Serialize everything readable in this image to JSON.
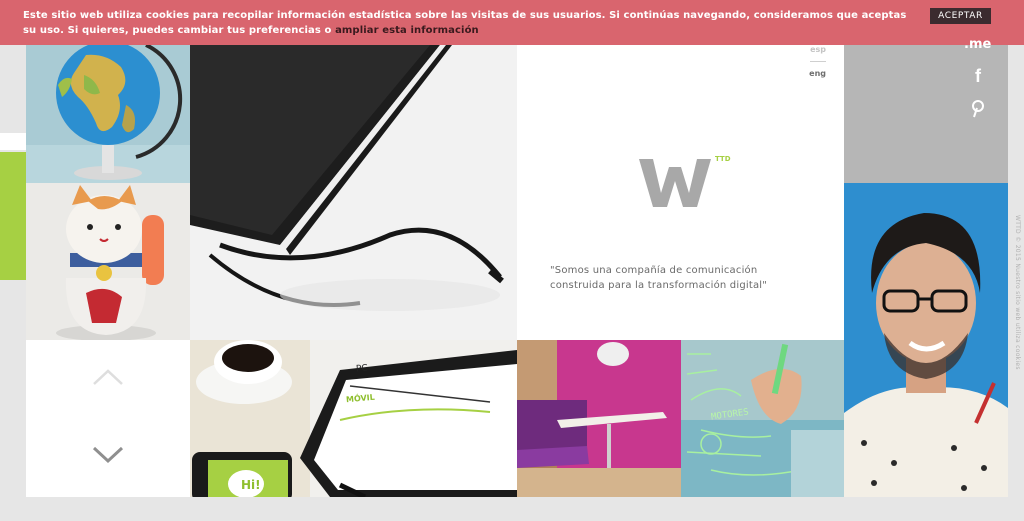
{
  "cookie_bar": {
    "message": "Este sitio web utiliza cookies para recopilar información estadística sobre las visitas de sus usuarios. Si continúas navegando, consideramos que aceptas su uso. Si quieres, puedes cambiar tus preferencias o ",
    "link_label": "ampliar esta información",
    "accept_label": "ACEPTAR"
  },
  "language": {
    "esp": "esp",
    "eng": "eng"
  },
  "brand": {
    "logo_letter": "W",
    "logo_sup": "TTD",
    "tagline_line1": "\"Somos una compañía de comunicación",
    "tagline_line2": "construida para la transformación digital\""
  },
  "social": {
    "me": ".me",
    "facebook": "f",
    "pinterest": "p"
  },
  "tablet_labels": {
    "pc": "PC",
    "movil": "MÓVIL",
    "hi": "Hi!"
  },
  "drawing_labels": {
    "motores": "MOTORES"
  },
  "footer": {
    "vertical_copy": "WTTD © 2015 Nuestro sitio web utiliza cookies"
  },
  "colors": {
    "cookie_bar": "#d9656e",
    "accent_green": "#a6d043",
    "portrait_blue": "#2f8ed0",
    "room_magenta": "#c3358b"
  }
}
